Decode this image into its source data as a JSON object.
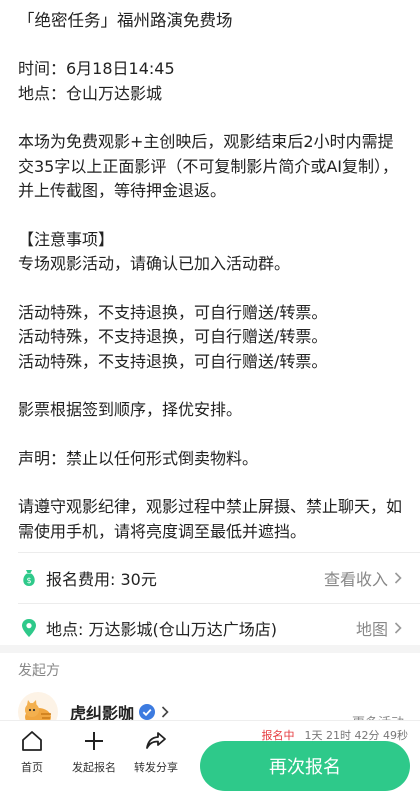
{
  "post": {
    "title": "「绝密任务」福州路演免费场",
    "time": "时间：6月18日14:45",
    "place": "地点：仓山万达影城",
    "desc": "本场为免费观影+主创映后，观影结束后2小时内需提交35字以上正面影评（不可复制影片简介或AI复制），并上传截图，等待押金退返。",
    "notice_title": "【注意事项】",
    "notice_line1": "专场观影活动，请确认已加入活动群。",
    "special_1": "活动特殊，不支持退换，可自行赠送/转票。",
    "special_2": "活动特殊，不支持退换，可自行赠送/转票。",
    "special_3": "活动特殊，不支持退换，可自行赠送/转票。",
    "ticket_order": "影票根据签到顺序，择优安排。",
    "statement": "声明：禁止以任何形式倒卖物料。",
    "discipline": "请遵守观影纪律，观影过程中禁止屏摄、禁止聊天，如需使用手机，请将亮度调至最低并遮挡。"
  },
  "fee": {
    "label": "报名费用: 30元",
    "action": "查看收入",
    "icon": "money-bag-icon"
  },
  "location": {
    "label": "地点: 万达影城(仓山万达广场店)",
    "action": "地图",
    "icon": "location-pin-icon"
  },
  "organizer": {
    "heading": "发起方",
    "name": "虎纠影咖",
    "more": "更多活动"
  },
  "bottom": {
    "nav": [
      {
        "label": "首页",
        "icon": "home-icon"
      },
      {
        "label": "发起报名",
        "icon": "plus-icon"
      },
      {
        "label": "转发分享",
        "icon": "share-icon"
      }
    ],
    "status_tag": "报名中",
    "countdown": "1天 21时 42分 49秒",
    "cta": "再次报名"
  },
  "colors": {
    "accent": "#2ec98a",
    "status_red": "#e5393d"
  }
}
